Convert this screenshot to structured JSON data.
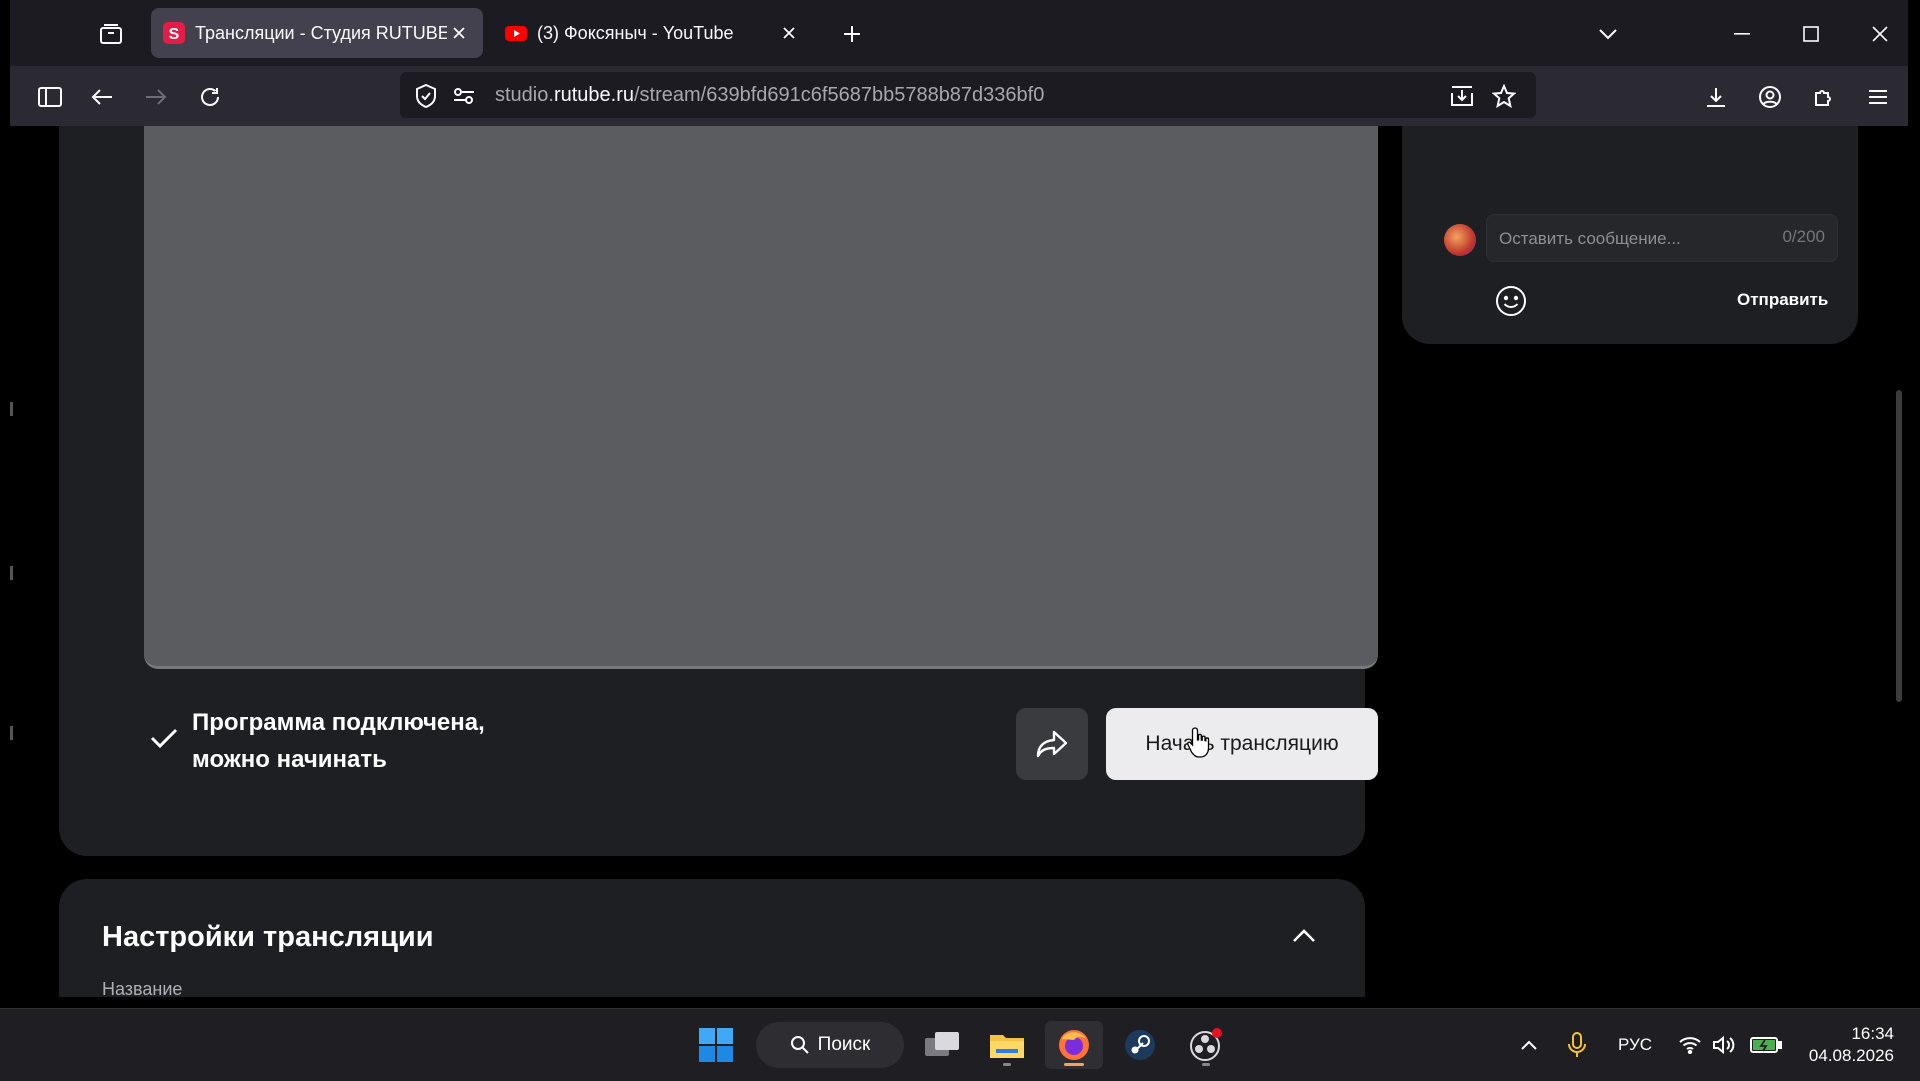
{
  "browser": {
    "tabs": [
      {
        "title": "Трансляции - Студия RUTUBE",
        "active": true,
        "favicon": "rutube-studio-icon",
        "favicon_color": "#e41d48"
      },
      {
        "title": "(3) Фоксяныч - YouTube",
        "active": false,
        "favicon": "youtube-icon",
        "favicon_color": "#ff0000"
      }
    ],
    "url": {
      "prefix": "studio.",
      "domain": "rutube.ru",
      "path": "/stream/639bfd691c6f5687bb5788b87d336bf0"
    }
  },
  "stream": {
    "status_line1": "Программа подключена,",
    "status_line2": "можно начинать",
    "start_label": "Начать трансляцию"
  },
  "settings": {
    "title": "Настройки трансляции",
    "name_label": "Название"
  },
  "chat": {
    "placeholder": "Оставить сообщение...",
    "counter": "0/200",
    "send_label": "Отправить"
  },
  "taskbar": {
    "search_label": "Поиск",
    "language": "РУС",
    "time": "16:34",
    "date": "04.08.2026"
  },
  "colors": {
    "accent": "#e41d48",
    "page_bg": "#000000",
    "card_bg": "#1e1f22",
    "video_bg": "#5b5c60"
  }
}
